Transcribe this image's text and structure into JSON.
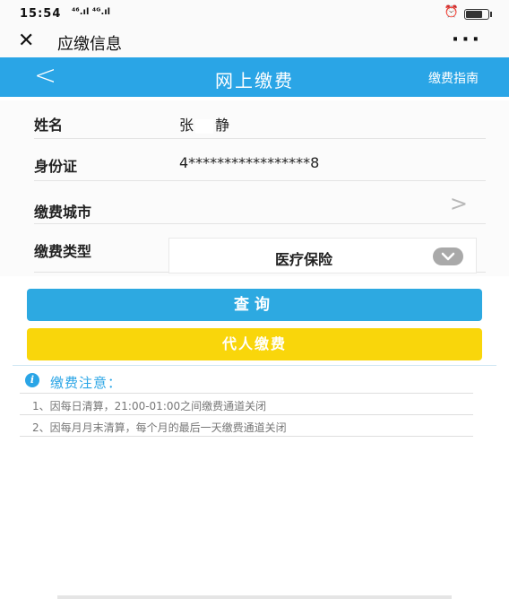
{
  "status_bar": {
    "time": "15:54",
    "signal": "⁴⁶.ıl ⁴ᴳ.ıl"
  },
  "wechat_bar": {
    "title": "应缴信息",
    "more": "···"
  },
  "app_bar": {
    "back": "<",
    "title": "网上缴费",
    "guide": "缴费指南"
  },
  "form": {
    "name_label": "姓名",
    "name_first": "张",
    "name_last": "静",
    "id_label": "身份证",
    "id_value": "4*****************8",
    "city_label": "缴费城市",
    "city_arrow": ">",
    "type_label": "缴费类型",
    "type_value": "医疗保险"
  },
  "buttons": {
    "query": "查询",
    "proxy": "代人缴费"
  },
  "notice": {
    "icon": "i",
    "title": "缴费注意：",
    "items": [
      "1、因每日清算，21:00-01:00之间缴费通道关闭",
      "2、因每月月末清算，每个月的最后一天缴费通道关闭"
    ]
  },
  "colors": {
    "primary": "#2aa5e6",
    "proxy_button": "#f9d60b"
  }
}
